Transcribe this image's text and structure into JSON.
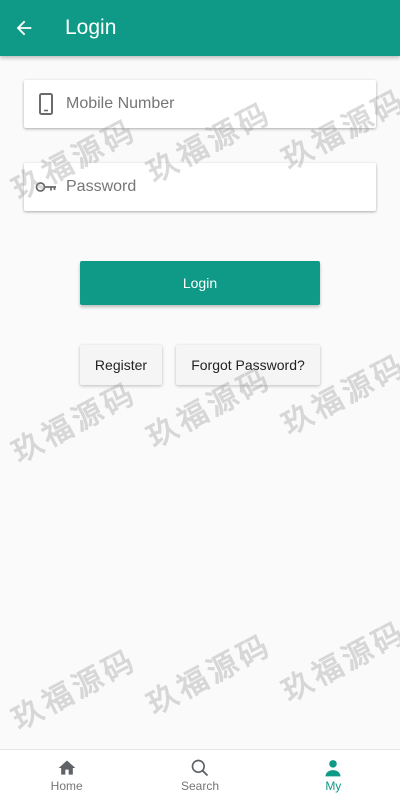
{
  "appbar": {
    "title": "Login"
  },
  "form": {
    "mobile_placeholder": "Mobile Number",
    "password_placeholder": "Password",
    "login_label": "Login",
    "register_label": "Register",
    "forgot_label": "Forgot Password?"
  },
  "watermark": "玖福源码",
  "bottom_nav": {
    "items": [
      {
        "label": "Home",
        "icon": "home-icon"
      },
      {
        "label": "Search",
        "icon": "search-icon"
      },
      {
        "label": "My",
        "icon": "person-icon",
        "active": true
      }
    ]
  },
  "colors": {
    "primary": "#0e9a86",
    "background": "#fafafa"
  }
}
